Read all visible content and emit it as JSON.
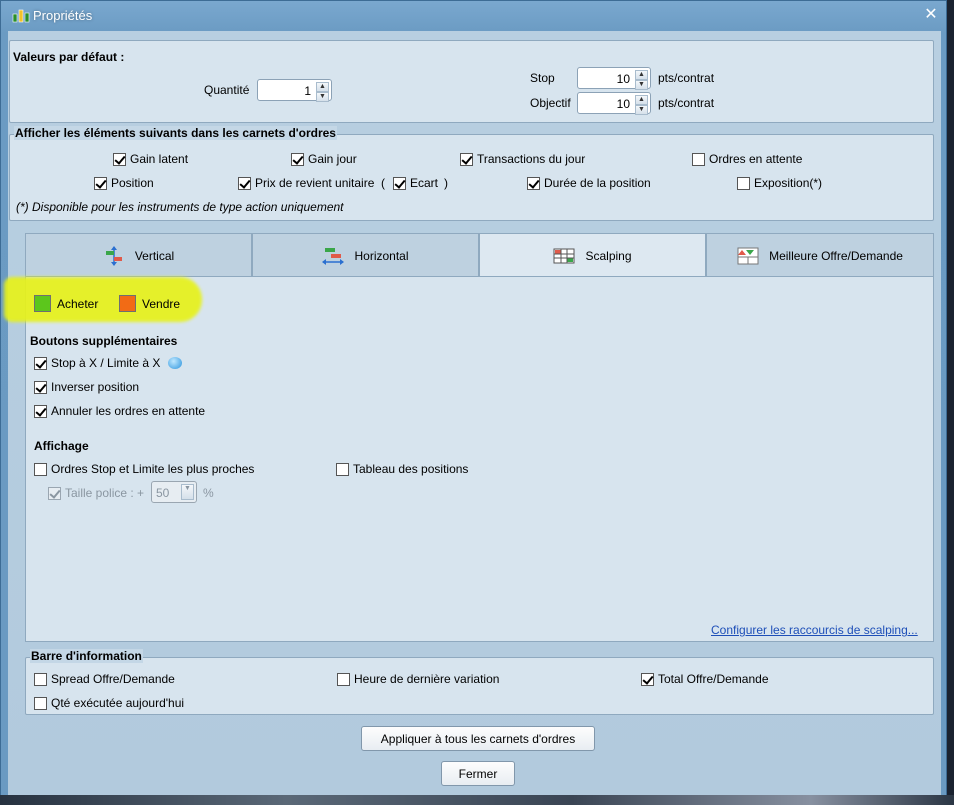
{
  "window": {
    "title": "Propriétés",
    "close_glyph": "✕"
  },
  "defaults": {
    "title": "Valeurs par défaut :",
    "quantity_label": "Quantité",
    "quantity_value": "1",
    "stop_label": "Stop",
    "stop_value": "10",
    "stop_unit": "pts/contrat",
    "target_label": "Objectif",
    "target_value": "10",
    "target_unit": "pts/contrat"
  },
  "display_elements": {
    "title": "Afficher les éléments suivants dans les carnets d'ordres",
    "items": [
      {
        "label": "Gain latent",
        "checked": true
      },
      {
        "label": "Gain jour",
        "checked": true
      },
      {
        "label": "Transactions du jour",
        "checked": true
      },
      {
        "label": "Ordres en attente",
        "checked": false
      },
      {
        "label": "Position",
        "checked": true
      },
      {
        "label": "Prix de revient unitaire",
        "checked": true
      },
      {
        "label": "Ecart",
        "checked": true
      },
      {
        "label": "Durée de la position",
        "checked": true
      },
      {
        "label": "Exposition(*)",
        "checked": false
      }
    ],
    "paren_open": "(",
    "paren_close": ")",
    "footnote": "(*) Disponible pour les instruments de type action uniquement"
  },
  "tabs": [
    {
      "label": "Vertical",
      "icon": "vertical-layout-icon",
      "active": false
    },
    {
      "label": "Horizontal",
      "icon": "horizontal-layout-icon",
      "active": false
    },
    {
      "label": "Scalping",
      "icon": "scalping-grid-icon",
      "active": true
    },
    {
      "label": "Meilleure Offre/Demande",
      "icon": "best-bid-ask-icon",
      "active": false
    }
  ],
  "scalping": {
    "buy_label": "Acheter",
    "buy_color": "#5cc61c",
    "sell_label": "Vendre",
    "sell_color": "#f26b15",
    "highlight_color": "#e7f21a",
    "extra_buttons_title": "Boutons supplémentaires",
    "extra_buttons": [
      {
        "label": "Stop à X / Limite à X",
        "checked": true
      },
      {
        "label": "Inverser position",
        "checked": true
      },
      {
        "label": "Annuler les ordres en attente",
        "checked": true
      }
    ],
    "display_title": "Affichage",
    "nearest_orders_label": "Ordres Stop et Limite les plus proches",
    "nearest_orders_checked": false,
    "positions_table_label": "Tableau des positions",
    "positions_table_checked": false,
    "font_size_label": "Taille police : +",
    "font_size_value": "50",
    "font_size_unit": "%",
    "shortcuts_link": "Configurer les raccourcis de scalping..."
  },
  "info_bar": {
    "title": "Barre d'information",
    "items": [
      {
        "label": "Spread Offre/Demande",
        "checked": false
      },
      {
        "label": "Heure de dernière variation",
        "checked": false
      },
      {
        "label": "Total Offre/Demande",
        "checked": true
      },
      {
        "label": "Qté exécutée aujourd'hui",
        "checked": false
      }
    ]
  },
  "buttons": {
    "apply_all": "Appliquer à tous les carnets d'ordres",
    "close": "Fermer"
  }
}
